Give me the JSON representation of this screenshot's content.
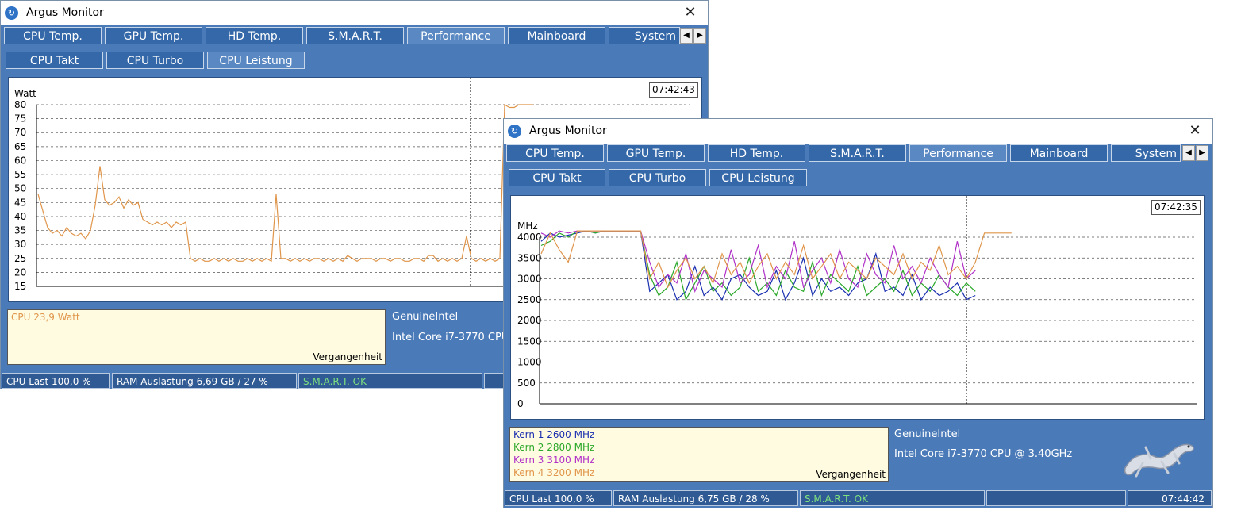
{
  "window1": {
    "title": "Argus Monitor",
    "tabs": [
      "CPU Temp.",
      "GPU Temp.",
      "HD Temp.",
      "S.M.A.R.T.",
      "Performance",
      "Mainboard",
      "System"
    ],
    "subtabs": [
      "CPU Takt",
      "CPU Turbo",
      "CPU Leistung"
    ],
    "time": "07:42:43",
    "legend": [
      {
        "label": "CPU  23,9 Watt",
        "color": "#e0954a"
      }
    ],
    "legend_footer": "Vergangenheit",
    "info_vendor": "GenuineIntel",
    "info_cpu": "Intel Core i7-3770 CPU",
    "status": [
      "CPU Last 100,0 %",
      "RAM Auslastung 6,69 GB / 27 %",
      "S.M.A.R.T. OK"
    ]
  },
  "window2": {
    "title": "Argus Monitor",
    "tabs": [
      "CPU Temp.",
      "GPU Temp.",
      "HD Temp.",
      "S.M.A.R.T.",
      "Performance",
      "Mainboard",
      "System"
    ],
    "subtabs": [
      "CPU Takt",
      "CPU Turbo",
      "CPU Leistung"
    ],
    "time": "07:42:35",
    "legend": [
      {
        "label": "Kern 1  2600 MHz",
        "color": "#1a2fb0"
      },
      {
        "label": "Kern 2  2800 MHz",
        "color": "#2aa82a"
      },
      {
        "label": "Kern 3  3100 MHz",
        "color": "#b030c8"
      },
      {
        "label": "Kern 4  3200 MHz",
        "color": "#e0954a"
      }
    ],
    "legend_footer": "Vergangenheit",
    "info_vendor": "GenuineIntel",
    "info_cpu": "Intel Core i7-3770 CPU @ 3.40GHz",
    "status": [
      "CPU Last 100,0 %",
      "RAM Auslastung 6,75 GB / 28 %",
      "S.M.A.R.T. OK",
      "",
      "07:44:42"
    ]
  },
  "chart_data": [
    {
      "type": "line",
      "ylabel": "Watt",
      "ylim": [
        15,
        80
      ],
      "yticks": [
        80,
        75,
        70,
        65,
        60,
        55,
        50,
        45,
        40,
        35,
        30,
        25,
        20,
        15
      ],
      "grid": true,
      "series": [
        {
          "name": "CPU",
          "color": "#e0954a",
          "values": [
            48,
            42,
            36,
            34,
            35,
            33,
            36,
            34,
            33,
            34,
            32,
            35,
            44,
            58,
            46,
            44,
            45,
            47,
            43,
            46,
            44,
            45,
            39,
            38,
            37,
            38,
            37,
            38,
            36,
            38,
            37,
            38,
            25,
            24,
            25,
            24,
            24,
            25,
            24,
            25,
            24,
            25,
            24,
            24,
            25,
            24,
            25,
            24,
            25,
            24,
            48,
            25,
            25,
            24,
            25,
            24,
            25,
            24,
            25,
            25,
            24,
            25,
            24,
            25,
            24,
            26,
            25,
            24,
            25,
            25,
            25,
            24,
            25,
            25,
            24,
            25,
            25,
            24,
            24,
            25,
            25,
            24,
            26,
            26,
            24,
            25,
            24,
            25,
            24,
            25,
            33,
            25,
            24,
            25,
            24,
            25,
            24,
            25,
            80,
            79,
            79,
            80,
            80,
            80,
            80
          ]
        }
      ]
    },
    {
      "type": "line",
      "ylabel": "MHz",
      "ylim": [
        0,
        4000
      ],
      "yticks": [
        4000,
        3500,
        3000,
        2500,
        2000,
        1500,
        1000,
        500,
        0
      ],
      "grid": true,
      "series": [
        {
          "name": "Kern 1",
          "color": "#1a2fb0",
          "values": [
            3900,
            4100,
            4000,
            4050,
            4100,
            4150,
            4100,
            4150,
            4150,
            4150,
            4150,
            4150,
            2700,
            2900,
            3100,
            2500,
            2700,
            3300,
            2600,
            2800,
            2500,
            3000,
            3100,
            2800,
            2600,
            2700,
            3200,
            2500,
            2900,
            3500,
            2600,
            3000,
            2700,
            2800,
            2600,
            2900,
            3000,
            3600,
            2700,
            2800,
            2600,
            3100,
            2500,
            2800,
            2600,
            2700,
            2900,
            2500,
            2600
          ]
        },
        {
          "name": "Kern 2",
          "color": "#2aa82a",
          "values": [
            3800,
            3900,
            4100,
            4000,
            4150,
            4150,
            4100,
            4150,
            4150,
            4150,
            4150,
            4150,
            3100,
            2600,
            2800,
            3400,
            2500,
            2900,
            3300,
            2700,
            2900,
            2600,
            2800,
            3500,
            2700,
            2900,
            2600,
            3200,
            2800,
            2700,
            3400,
            2600,
            3100,
            2900,
            2700,
            3300,
            2600,
            2800,
            3000,
            2700,
            3200,
            2600,
            2900,
            2700,
            3100,
            2800,
            2600,
            2900,
            2700
          ]
        },
        {
          "name": "Kern 3",
          "color": "#b030c8",
          "values": [
            4100,
            4000,
            4150,
            4100,
            4150,
            4150,
            4150,
            4150,
            4150,
            4150,
            4150,
            4150,
            3400,
            2800,
            3100,
            2900,
            3600,
            2700,
            3200,
            3000,
            2800,
            3700,
            2900,
            3100,
            3800,
            2800,
            3300,
            3000,
            3900,
            2800,
            3200,
            3500,
            2900,
            3700,
            3000,
            2800,
            3600,
            3100,
            2900,
            3800,
            3000,
            3300,
            2900,
            3500,
            3100,
            2800,
            3900,
            3000,
            3200
          ]
        },
        {
          "name": "Kern 4",
          "color": "#e0954a",
          "values": [
            3600,
            4100,
            3700,
            3400,
            4150,
            4150,
            4150,
            4150,
            4150,
            4150,
            4150,
            4150,
            3000,
            3400,
            2800,
            3200,
            3500,
            3000,
            3300,
            2900,
            3600,
            3100,
            3400,
            2900,
            3300,
            3600,
            3000,
            3400,
            3100,
            3800,
            3000,
            3300,
            3600,
            3000,
            3400,
            3200,
            3000,
            3500,
            3300,
            3100,
            3600,
            3000,
            3400,
            3200,
            3800,
            3100,
            3300,
            3000,
            3400,
            4100,
            4100,
            4100,
            4100
          ]
        }
      ]
    }
  ]
}
